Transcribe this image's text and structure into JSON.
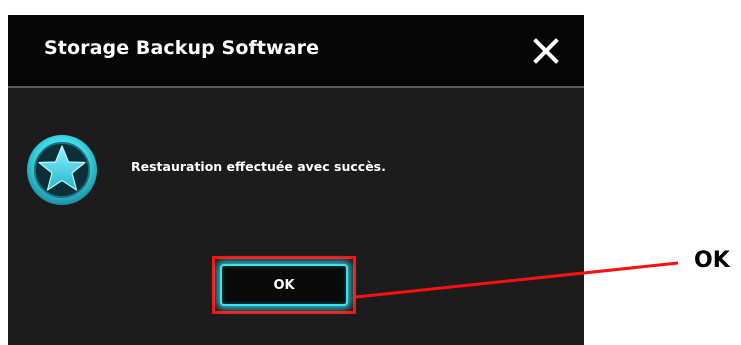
{
  "window": {
    "title": "Storage Backup Software",
    "close_icon": "close-icon"
  },
  "dialog": {
    "icon": "star-icon",
    "message": "Restauration effectuée avec succès.",
    "ok_label": "OK"
  },
  "annotation": {
    "label": "OK",
    "color": "#ff0f0f"
  },
  "colors": {
    "accent": "#38e6f0",
    "dialog_background": "#1c1c1c",
    "titlebar_background": "#060606"
  }
}
